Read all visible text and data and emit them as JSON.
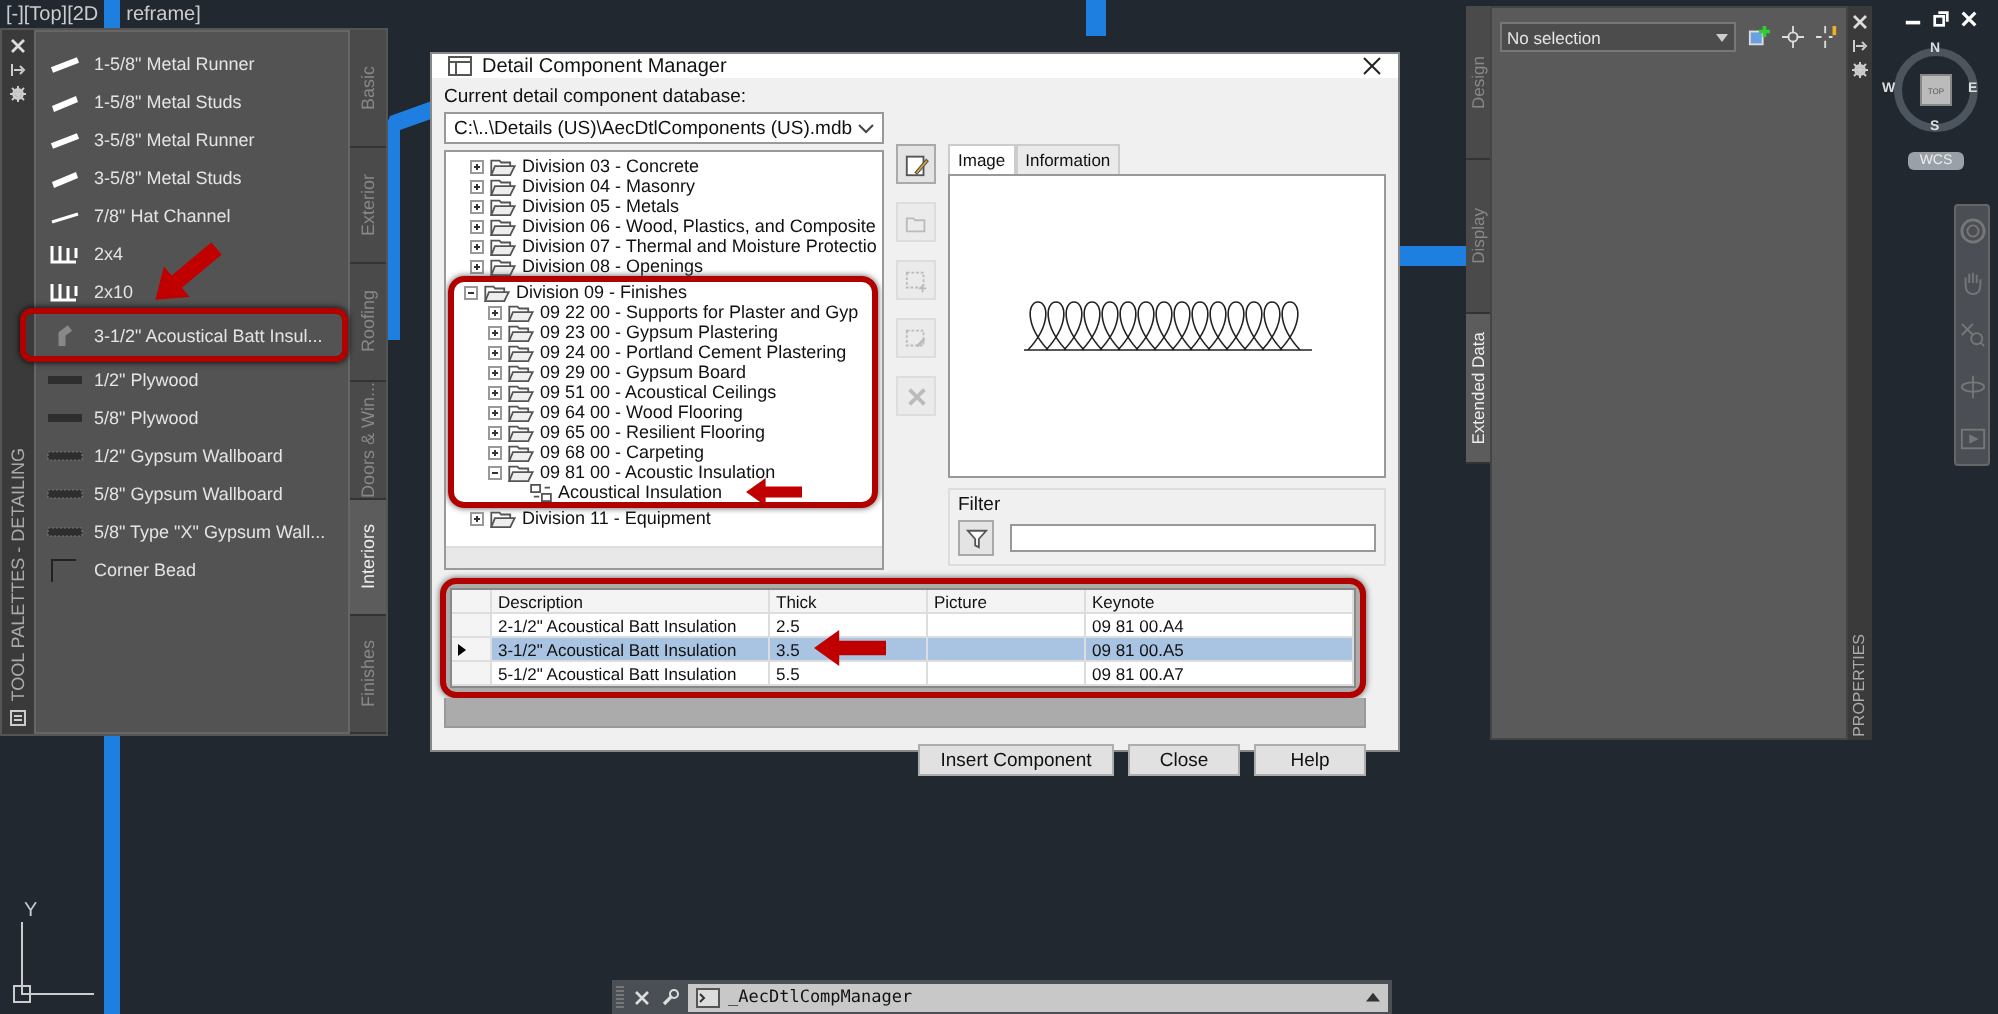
{
  "viewport_label": [
    "[-][Top][2D",
    "reframe]"
  ],
  "tool_palette": {
    "title": "TOOL PALETTES - DETAILING",
    "items": [
      {
        "label": "1-5/8\" Metal Runner",
        "kind": "runner",
        "callout": false
      },
      {
        "label": "1-5/8\" Metal Studs",
        "kind": "studs",
        "callout": false
      },
      {
        "label": "3-5/8\" Metal Runner",
        "kind": "runner",
        "callout": false
      },
      {
        "label": "3-5/8\" Metal Studs",
        "kind": "studs",
        "callout": false
      },
      {
        "label": "7/8\" Hat Channel",
        "kind": "channel",
        "callout": false
      },
      {
        "label": "2x4",
        "kind": "lumber",
        "callout": false
      },
      {
        "label": "2x10",
        "kind": "lumber",
        "callout": false
      },
      {
        "label": "3-1/2\" Acoustical Batt Insul...",
        "kind": "batt",
        "callout": true
      },
      {
        "label": "1/2\" Plywood",
        "kind": "plywood",
        "callout": false
      },
      {
        "label": "5/8\" Plywood",
        "kind": "plywood",
        "callout": false
      },
      {
        "label": "1/2\" Gypsum Wallboard",
        "kind": "gypsum",
        "callout": false
      },
      {
        "label": "5/8\" Gypsum Wallboard",
        "kind": "gypsum",
        "callout": false
      },
      {
        "label": "5/8\" Type \"X\" Gypsum Wall...",
        "kind": "gypsum",
        "callout": false
      },
      {
        "label": "Corner Bead",
        "kind": "bead",
        "callout": false
      }
    ],
    "tabs": [
      {
        "label": "Basic",
        "selected": false
      },
      {
        "label": "Exterior",
        "selected": false
      },
      {
        "label": "Roofing",
        "selected": false
      },
      {
        "label": "Doors & Win...",
        "selected": false
      },
      {
        "label": "Interiors",
        "selected": true
      },
      {
        "label": "Finishes",
        "selected": false
      }
    ]
  },
  "dialog": {
    "title": "Detail Component Manager",
    "database_label": "Current detail component database:",
    "database_value": "C:\\..\\Details (US)\\AecDtlComponents (US).mdb",
    "tree": [
      {
        "label": "Division 03 - Concrete",
        "expanded": false,
        "callout": false
      },
      {
        "label": "Division 04 - Masonry",
        "expanded": false,
        "callout": false
      },
      {
        "label": "Division 05 - Metals",
        "expanded": false,
        "callout": false
      },
      {
        "label": "Division 06 - Wood, Plastics, and Composite",
        "expanded": false,
        "callout": false
      },
      {
        "label": "Division 07 - Thermal and Moisture Protectio",
        "expanded": false,
        "callout": false
      },
      {
        "label": "Division 08 - Openings",
        "expanded": false,
        "callout": false
      },
      {
        "label": "Division 09 - Finishes",
        "expanded": true,
        "callout": true,
        "children": [
          {
            "label": "09 22 00 - Supports for Plaster and Gyp",
            "expanded": false
          },
          {
            "label": "09 23 00 - Gypsum Plastering",
            "expanded": false
          },
          {
            "label": "09 24 00 - Portland Cement Plastering",
            "expanded": false
          },
          {
            "label": "09 29 00 - Gypsum Board",
            "expanded": false
          },
          {
            "label": "09 51 00 - Acoustical Ceilings",
            "expanded": false
          },
          {
            "label": "09 64 00 - Wood Flooring",
            "expanded": false
          },
          {
            "label": "09 65 00 - Resilient Flooring",
            "expanded": false
          },
          {
            "label": "09 68 00 - Carpeting",
            "expanded": false
          },
          {
            "label": "09 81 00 - Acoustic Insulation",
            "expanded": true,
            "children": [
              {
                "label": "Acoustical Insulation",
                "arrow": true
              }
            ]
          }
        ]
      },
      {
        "label": "Division 11 - Equipment",
        "expanded": false,
        "callout": false
      }
    ],
    "tool_buttons": [
      {
        "kind": "edit",
        "disabled": false
      },
      {
        "kind": "open",
        "disabled": true
      },
      {
        "kind": "add",
        "disabled": true
      },
      {
        "kind": "modify",
        "disabled": true
      },
      {
        "kind": "delete",
        "disabled": true
      }
    ],
    "preview_tabs": [
      {
        "label": "Image",
        "selected": true
      },
      {
        "label": "Information",
        "selected": false
      }
    ],
    "filter": {
      "label": "Filter"
    },
    "grid": {
      "callout": true,
      "columns": [
        "Description",
        "Thick",
        "Picture",
        "Keynote"
      ],
      "rows": [
        {
          "cells": [
            "2-1/2\" Acoustical Batt Insulation",
            "2.5",
            "",
            "09 81 00.A4"
          ],
          "selected": false,
          "arrow": false
        },
        {
          "cells": [
            "3-1/2\" Acoustical Batt Insulation",
            "3.5",
            "",
            "09 81 00.A5"
          ],
          "selected": true,
          "arrow": true
        },
        {
          "cells": [
            "5-1/2\" Acoustical Batt Insulation",
            "5.5",
            "",
            "09 81 00.A7"
          ],
          "selected": false,
          "arrow": false
        }
      ]
    },
    "buttons": [
      "Insert Component",
      "Close",
      "Help"
    ]
  },
  "properties_palette": {
    "title": "PROPERTIES",
    "selection": "No selection",
    "tabs": [
      {
        "label": "Design",
        "selected": false
      },
      {
        "label": "Display",
        "selected": false
      },
      {
        "label": "Extended Data",
        "selected": true
      }
    ]
  },
  "viewcube": {
    "face": "TOP",
    "north": "N",
    "south": "S",
    "east": "E",
    "west": "W",
    "coordinate_system": "WCS"
  },
  "ucs": {
    "y_axis": "Y"
  },
  "command_line": {
    "value": "_AecDtlCompManager"
  }
}
